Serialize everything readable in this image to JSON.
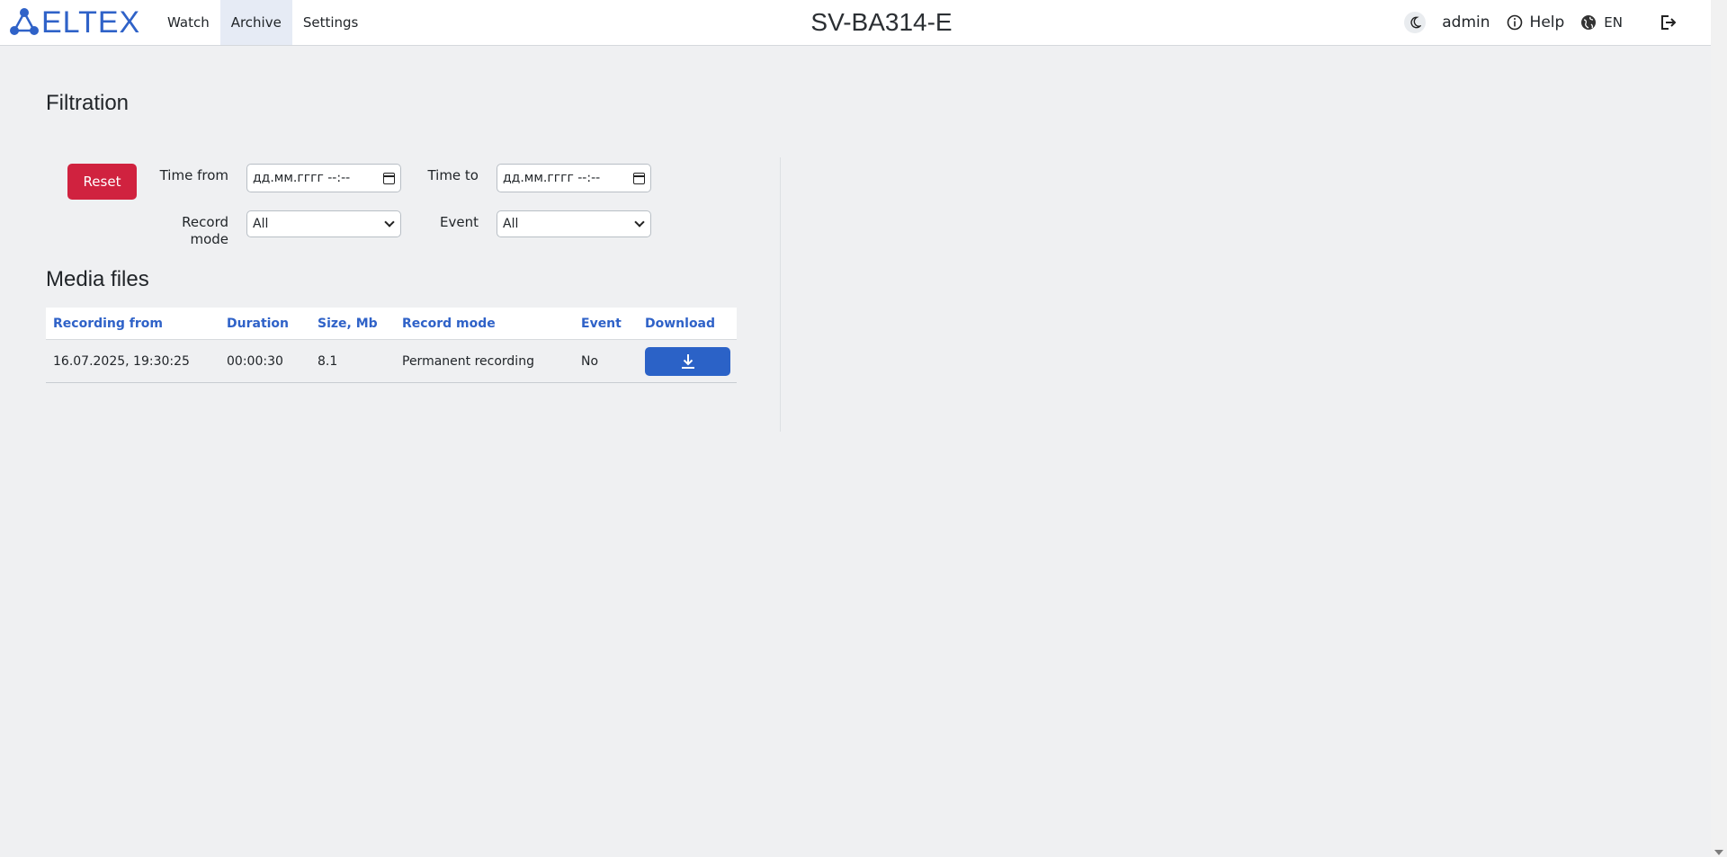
{
  "brand": {
    "logo_text": "ELTEX",
    "accent": "#2f62c8"
  },
  "nav": {
    "items": [
      {
        "label": "Watch",
        "active": false
      },
      {
        "label": "Archive",
        "active": true
      },
      {
        "label": "Settings",
        "active": false
      }
    ]
  },
  "device_title": "SV-BA314-E",
  "toolbar": {
    "user": "admin",
    "help_label": "Help",
    "language": "EN"
  },
  "filtration": {
    "title": "Filtration",
    "reset_label": "Reset",
    "time_from_label": "Time from",
    "time_from_placeholder": "дд.мм.гггг --:--",
    "time_to_label": "Time to",
    "time_to_placeholder": "дд.мм.гггг --:--",
    "record_mode_label_1": "Record",
    "record_mode_label_2": "mode",
    "record_mode_value": "All",
    "event_label": "Event",
    "event_value": "All",
    "reset_color": "#d0223f"
  },
  "media_files": {
    "title": "Media files",
    "columns": [
      "Recording from",
      "Duration",
      "Size, Mb",
      "Record mode",
      "Event",
      "Download"
    ],
    "rows": [
      {
        "recording_from": "16.07.2025, 19:30:25",
        "duration": "00:00:30",
        "size": "8.1",
        "record_mode": "Permanent recording",
        "event": "No"
      }
    ],
    "download_color": "#2b62c7"
  }
}
